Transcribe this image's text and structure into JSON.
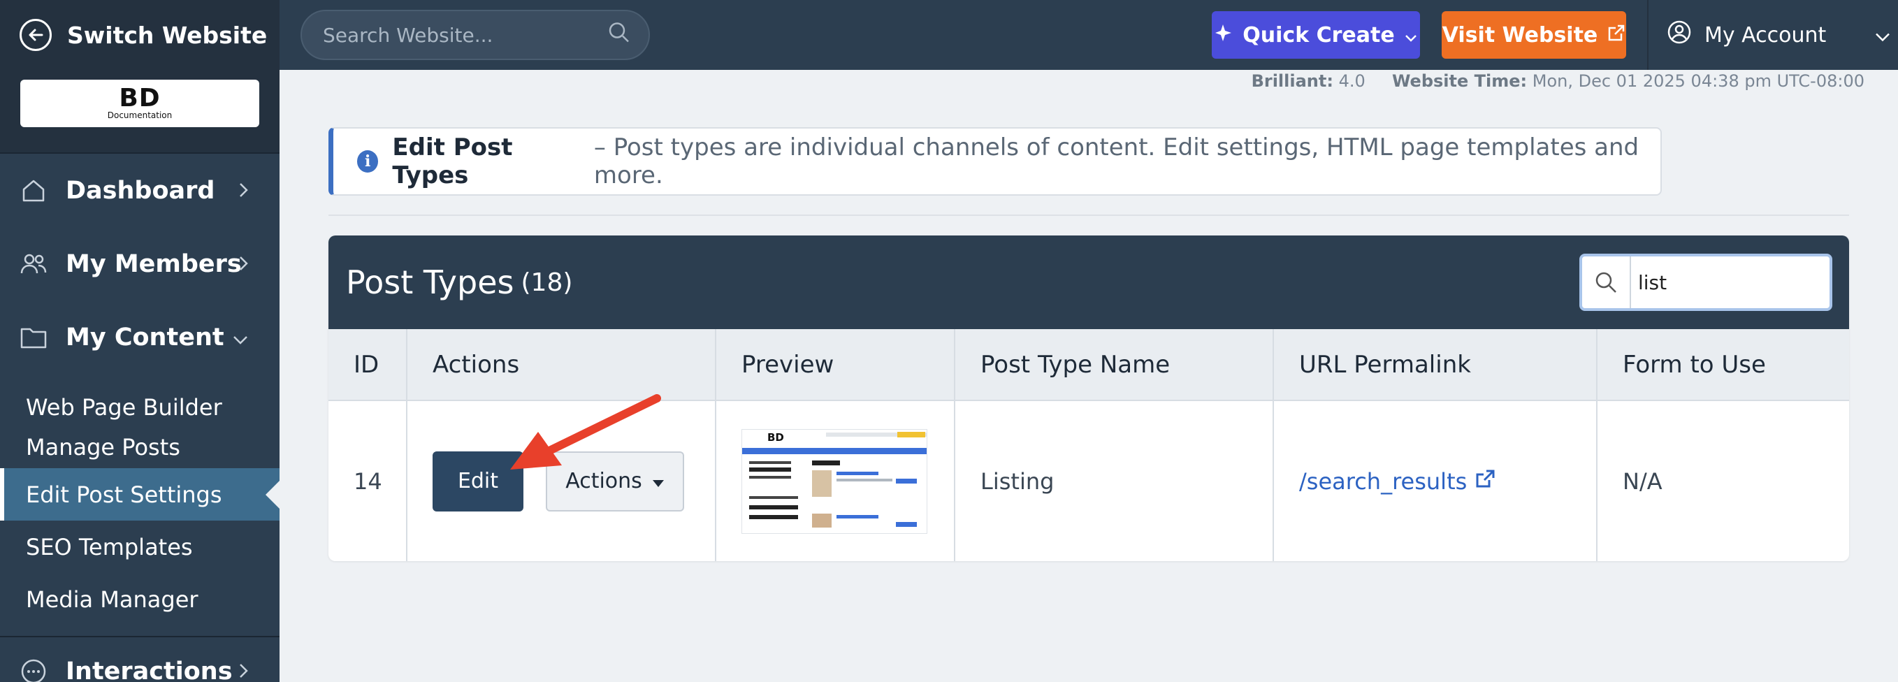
{
  "sidebar": {
    "switch_label": "Switch Website",
    "logo_text": "BD",
    "logo_sub": "Documentation",
    "nav": [
      {
        "label": "Dashboard",
        "icon": "home-icon"
      },
      {
        "label": "My Members",
        "icon": "users-icon"
      },
      {
        "label": "My Content",
        "icon": "folder-icon"
      }
    ],
    "sub": [
      {
        "label": "Web Page Builder"
      },
      {
        "label": "Manage Posts"
      },
      {
        "label": "Edit Post Settings",
        "active": true
      },
      {
        "label": "SEO Templates"
      },
      {
        "label": "Media Manager"
      }
    ],
    "bottom": {
      "label": "Interactions",
      "icon": "chat-icon"
    }
  },
  "topbar": {
    "search_placeholder": "Search Website...",
    "quick_create": "Quick Create",
    "visit_website": "Visit Website",
    "account": "My Account"
  },
  "meta": {
    "version_label": "Brilliant:",
    "version_value": "4.0",
    "time_label": "Website Time:",
    "time_value": "Mon, Dec 01 2025 04:38 pm UTC-08:00"
  },
  "info": {
    "title": "Edit Post Types",
    "text": "– Post types are individual channels of content. Edit settings, HTML page templates and more."
  },
  "panel": {
    "title": "Post Types",
    "count": "(18)",
    "search_value": "list",
    "columns": [
      "ID",
      "Actions",
      "Preview",
      "Post Type Name",
      "URL Permalink",
      "Form to Use"
    ],
    "rows": [
      {
        "id": "14",
        "edit": "Edit",
        "actions": "Actions",
        "name": "Listing",
        "permalink": "/search_results",
        "form": "N/A"
      }
    ]
  },
  "colors": {
    "sidebar_bg": "#2c3e50",
    "quick_create_bg": "#4b4ddb",
    "visit_website_bg": "#ee6f23",
    "active_nav_bg": "#3d6c8d",
    "arrow": "#e8402b"
  }
}
